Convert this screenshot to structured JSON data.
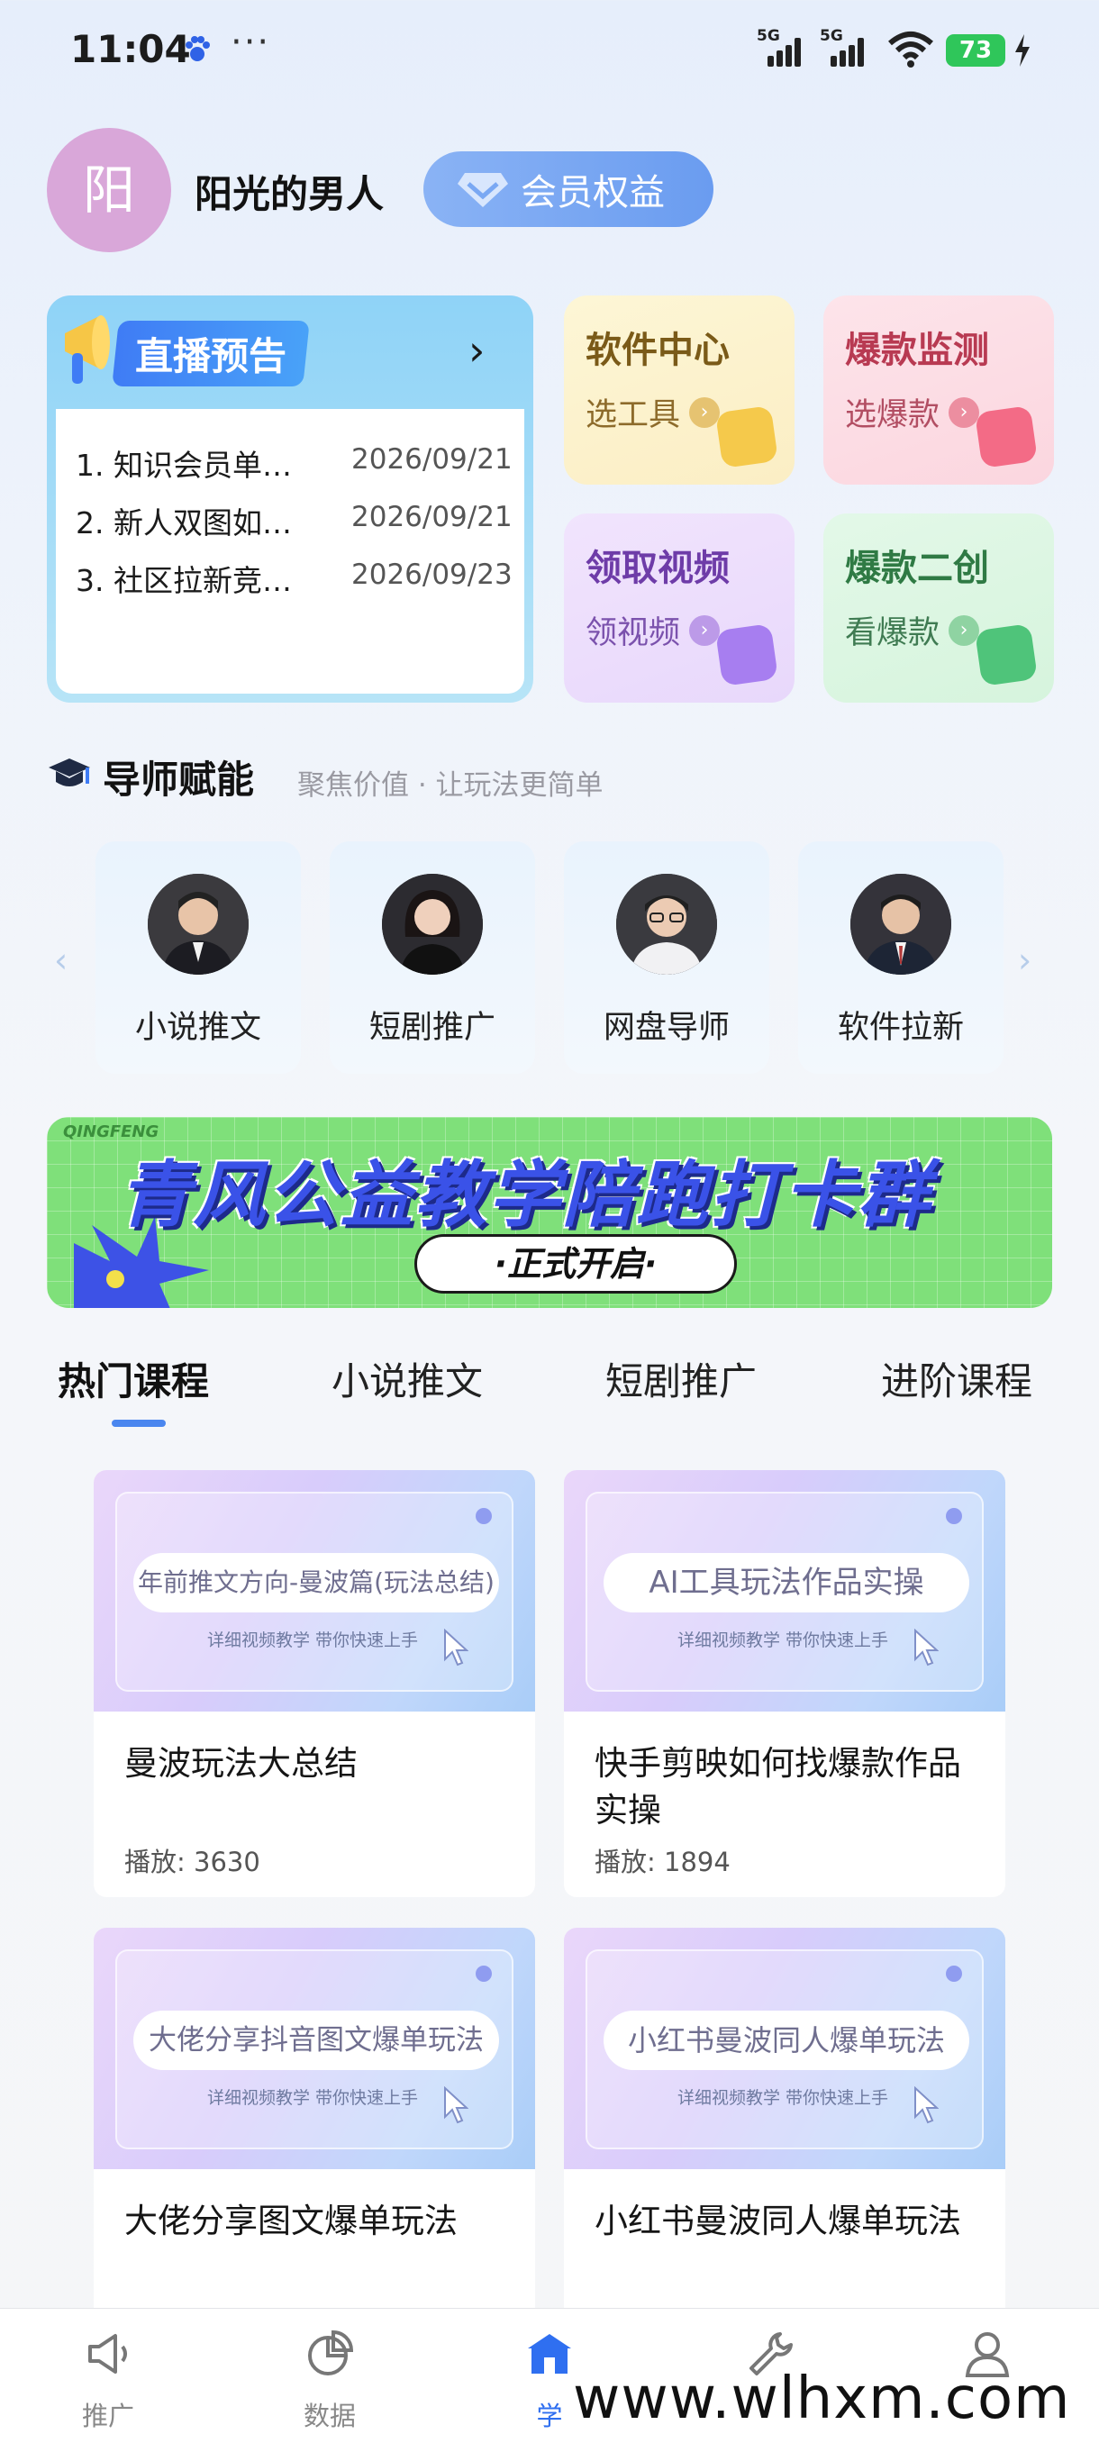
{
  "status_bar": {
    "time": "11:04",
    "more": "···",
    "net1": "5G",
    "net2": "5G",
    "battery": "73"
  },
  "profile": {
    "avatar_char": "阳",
    "name": "阳光的男人",
    "vip_label": "会员权益"
  },
  "live_preview": {
    "title": "直播预告",
    "items": [
      {
        "no": "1.",
        "title": "知识会员单…",
        "date": "2026/09/21"
      },
      {
        "no": "2.",
        "title": "新人双图如…",
        "date": "2026/09/21"
      },
      {
        "no": "3.",
        "title": "社区拉新竞…",
        "date": "2026/09/23"
      }
    ]
  },
  "tools": [
    {
      "title": "软件中心",
      "sub": "选工具"
    },
    {
      "title": "爆款监测",
      "sub": "选爆款"
    },
    {
      "title": "领取视频",
      "sub": "领视频"
    },
    {
      "title": "爆款二创",
      "sub": "看爆款"
    }
  ],
  "mentors": {
    "title": "导师赋能",
    "subtitle": "聚焦价值 · 让玩法更简单",
    "items": [
      {
        "name": "小说推文"
      },
      {
        "name": "短剧推广"
      },
      {
        "name": "网盘导师"
      },
      {
        "name": "软件拉新"
      }
    ]
  },
  "banner": {
    "top_text": "QINGFENG",
    "main_text": "青风公益教学陪跑打卡群",
    "pill_text": "·正式开启·"
  },
  "tabs": [
    {
      "label": "热门课程",
      "active": true
    },
    {
      "label": "小说推文",
      "active": false
    },
    {
      "label": "短剧推广",
      "active": false
    },
    {
      "label": "进阶课程",
      "active": false
    }
  ],
  "courses": [
    {
      "thumb_text": "年前推文方向-曼波篇(玩法总结)",
      "hint": "详细视频教学  带你快速上手",
      "title": "曼波玩法大总结",
      "plays": "播放: 3630"
    },
    {
      "thumb_text": "AI工具玩法作品实操",
      "hint": "详细视频教学  带你快速上手",
      "title": "快手剪映如何找爆款作品实操",
      "plays": "播放: 1894"
    },
    {
      "thumb_text": "大佬分享抖音图文爆单玩法",
      "hint": "详细视频教学  带你快速上手",
      "title": "大佬分享图文爆单玩法",
      "plays": ""
    },
    {
      "thumb_text": "小红书曼波同人爆单玩法",
      "hint": "详细视频教学  带你快速上手",
      "title": "小红书曼波同人爆单玩法",
      "plays": ""
    }
  ],
  "bottom_nav": [
    {
      "label": "推广",
      "icon": "megaphone-icon",
      "active": false
    },
    {
      "label": "数据",
      "icon": "pie-chart-icon",
      "active": false
    },
    {
      "label": "学",
      "icon": "school-icon",
      "active": true
    },
    {
      "label": "",
      "icon": "wrench-icon",
      "active": false
    },
    {
      "label": "",
      "icon": "user-icon",
      "active": false
    }
  ],
  "watermark": "www.wlhxm.com",
  "colors": {
    "accent": "#4a86ef",
    "vip": "#7aa8f3",
    "banner_green": "#7fe07a",
    "banner_text": "#3a52e8"
  }
}
